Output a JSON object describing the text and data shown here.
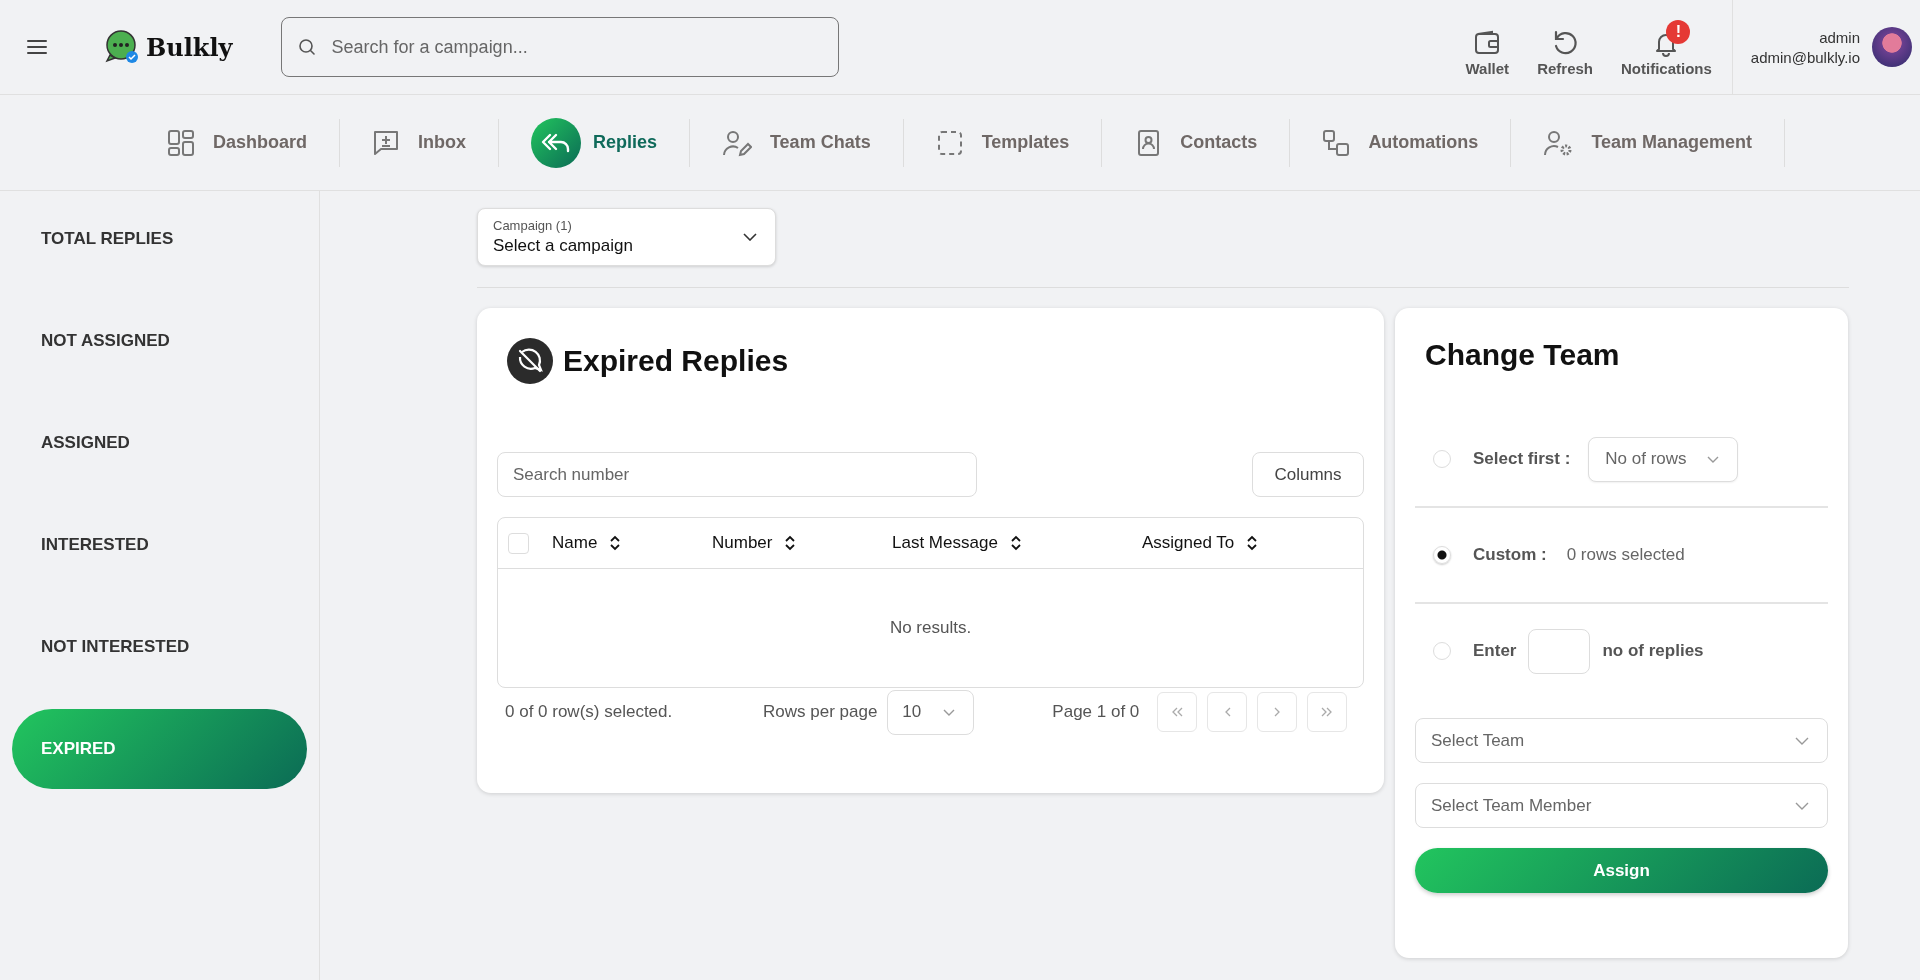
{
  "header": {
    "brand": "Bulkly",
    "search": {
      "placeholder": "Search for a campaign..."
    },
    "actions": [
      {
        "kind": "wallet",
        "label": "Wallet"
      },
      {
        "kind": "refresh",
        "label": "Refresh"
      },
      {
        "kind": "bell",
        "label": "Notifications",
        "badge": "!"
      }
    ],
    "user": {
      "name": "admin",
      "email": "admin@bulkly.io"
    }
  },
  "nav": [
    {
      "kind": "dashboard",
      "label": "Dashboard",
      "selected": false
    },
    {
      "kind": "inbox",
      "label": "Inbox",
      "selected": false
    },
    {
      "kind": "replies",
      "label": "Replies",
      "selected": true
    },
    {
      "kind": "team_chats",
      "label": "Team Chats",
      "selected": false
    },
    {
      "kind": "templates",
      "label": "Templates",
      "selected": false
    },
    {
      "kind": "contacts",
      "label": "Contacts",
      "selected": false
    },
    {
      "kind": "automations",
      "label": "Automations",
      "selected": false
    },
    {
      "kind": "team_management",
      "label": "Team Management",
      "selected": false
    }
  ],
  "sidebar": [
    {
      "label": "TOTAL REPLIES",
      "selected": false
    },
    {
      "label": "NOT ASSIGNED",
      "selected": false
    },
    {
      "label": "ASSIGNED",
      "selected": false
    },
    {
      "label": "INTERESTED",
      "selected": false
    },
    {
      "label": "NOT INTERESTED",
      "selected": false
    },
    {
      "label": "EXPIRED",
      "selected": true
    }
  ],
  "campaign_select": {
    "label": "Campaign (1)",
    "value": "Select a campaign"
  },
  "replies_card": {
    "title": "Expired Replies",
    "search": {
      "placeholder": "Search number"
    },
    "columns_button": "Columns",
    "table": {
      "select_all": {
        "checked": false
      },
      "columns": [
        "Name",
        "Number",
        "Last Message",
        "Assigned To"
      ],
      "empty_text": "No results."
    },
    "footer": {
      "selection": "0 of 0 row(s) selected.",
      "rows_per_page_label": "Rows per page",
      "rows_per_page": "10",
      "page": "Page 1 of 0"
    }
  },
  "change_team": {
    "title": "Change Team",
    "options": [
      {
        "kind": "select_first",
        "label": "Select first :",
        "selected": false,
        "placeholder": "No of rows"
      },
      {
        "kind": "custom",
        "label": "Custom :",
        "selected": true,
        "note": "0 rows selected"
      },
      {
        "kind": "enter",
        "label": "Enter",
        "selected": false,
        "suffix": "no of replies"
      }
    ],
    "team_select": {
      "placeholder": "Select Team"
    },
    "member_select": {
      "placeholder": "Select Team Member"
    },
    "assign_button": "Assign"
  }
}
